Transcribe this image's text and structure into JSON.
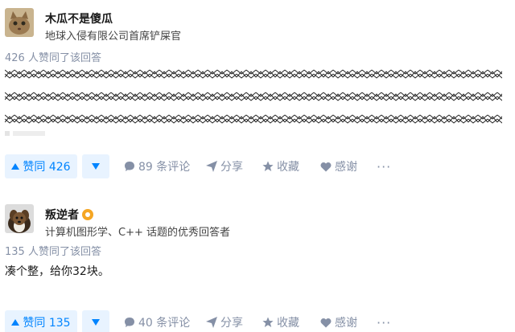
{
  "answers": [
    {
      "author": {
        "name": "木瓜不是傻瓜",
        "bio": "地球入侵有限公司首席铲屎官",
        "avatar": "cat-avatar"
      },
      "vote_summary": "426 人赞同了该回答",
      "content_type": "scribbled-out-text",
      "actions": {
        "upvote_label": "赞同 426",
        "comment_label": "89 条评论",
        "share_label": "分享",
        "favorite_label": "收藏",
        "thanks_label": "感谢",
        "more_label": "···"
      }
    },
    {
      "author": {
        "name": "叛逆者",
        "bio": "计算机图形学、C++ 话题的优秀回答者",
        "avatar": "dog-avatar",
        "badge": "excellent-answerer-badge"
      },
      "vote_summary": "135 人赞同了该回答",
      "content_text": "凑个整，给你32块。",
      "actions": {
        "upvote_label": "赞同 135",
        "comment_label": "40 条评论",
        "share_label": "分享",
        "favorite_label": "收藏",
        "thanks_label": "感谢",
        "more_label": "···"
      }
    }
  ],
  "icons": {
    "upvote": "triangle-up-icon",
    "downvote": "triangle-down-icon",
    "comment": "comment-bubble-icon",
    "share": "paper-plane-icon",
    "favorite": "star-icon",
    "thanks": "heart-icon",
    "more": "ellipsis-icon"
  },
  "colors": {
    "accent": "#0084ff",
    "accent_bg": "#e8f3ff",
    "meta": "#8590a6",
    "badge": "#f5a623"
  }
}
